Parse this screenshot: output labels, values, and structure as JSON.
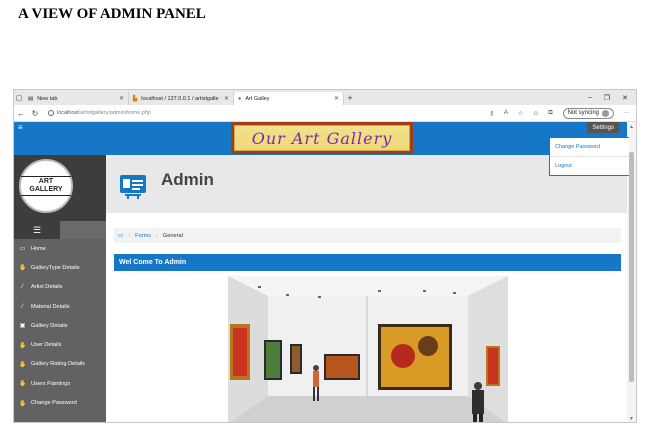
{
  "doc": {
    "heading": "A VIEW OF ADMIN PANEL"
  },
  "browser": {
    "tabs": [
      {
        "label": "New tab"
      },
      {
        "label": "localhost / 127.0.0.1 / artistgalle"
      },
      {
        "label": "Art Galley"
      }
    ],
    "url_host": "localhost",
    "url_path": "/artistgallery/admin/home.php",
    "sync_label": "Not syncing"
  },
  "app": {
    "logo_text": "Our Art Gallery",
    "settings_label": "Settings",
    "dropdown": [
      "Change Password",
      "Logout"
    ],
    "avatar_logo": "ART GALLERY",
    "sidebar": [
      {
        "label": "Home",
        "icon": "monitor-icon"
      },
      {
        "label": "GalleryType Details",
        "icon": "hand-icon"
      },
      {
        "label": "Artist Details",
        "icon": "brush-icon"
      },
      {
        "label": "Material Details",
        "icon": "brush-icon"
      },
      {
        "label": "Gallery Details",
        "icon": "gallery-icon"
      },
      {
        "label": "User Details",
        "icon": "hand-icon"
      },
      {
        "label": "Gallery Rating Details",
        "icon": "hand-icon"
      },
      {
        "label": "Users Paintings",
        "icon": "hand-icon"
      },
      {
        "label": "Change Password",
        "icon": "hand-icon"
      }
    ],
    "page_title": "Admin",
    "breadcrumb": {
      "link": "Forms",
      "current": "General"
    },
    "welcome": "Wel Come To Admin"
  }
}
